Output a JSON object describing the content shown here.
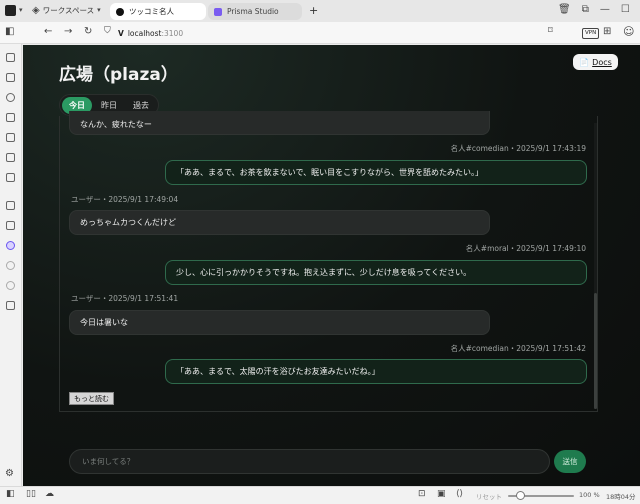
{
  "browser": {
    "workspace_label": "ワークスペース",
    "tabs": [
      {
        "label": "ツッコミ名人",
        "active": true
      },
      {
        "label": "Prisma Studio",
        "active": false
      }
    ],
    "new_tab": "+",
    "url_host": "localhost",
    "url_port": ":3100",
    "vpn_label": "VPN"
  },
  "page": {
    "title": "広場（plaza）",
    "docs_label": "Docs",
    "docs_icon": "📄",
    "tabs": [
      "今日",
      "昨日",
      "過去"
    ],
    "selected_tab": "今日"
  },
  "messages": [
    {
      "type": "user",
      "text": "なんか、疲れたなー"
    },
    {
      "type": "bot",
      "meta": "名人#comedian・2025/9/1 17:43:19",
      "text": "「ああ、まるで、お茶を飲まないで、眠い目をこすりながら、世界を舐めたみたい。」"
    },
    {
      "type": "user",
      "meta": "ユーザー・2025/9/1 17:49:04",
      "text": "めっちゃムカつくんだけど"
    },
    {
      "type": "bot",
      "meta": "名人#moral・2025/9/1 17:49:10",
      "text": "少し、心に引っかかりそうですね。抱え込まずに、少しだけ息を吸ってください。"
    },
    {
      "type": "user",
      "meta": "ユーザー・2025/9/1 17:51:41",
      "text": "今日は暑いな"
    },
    {
      "type": "bot",
      "meta": "名人#comedian・2025/9/1 17:51:42",
      "text": "「ああ、まるで、太陽の汗を浴びたお友達みたいだね。」"
    }
  ],
  "more_label": "もっと読む",
  "composer": {
    "placeholder": "いま何してる？",
    "send_label": "送信"
  },
  "statusbar": {
    "reset_label": "リセット",
    "zoom": "100 %",
    "time": "18時04分"
  }
}
